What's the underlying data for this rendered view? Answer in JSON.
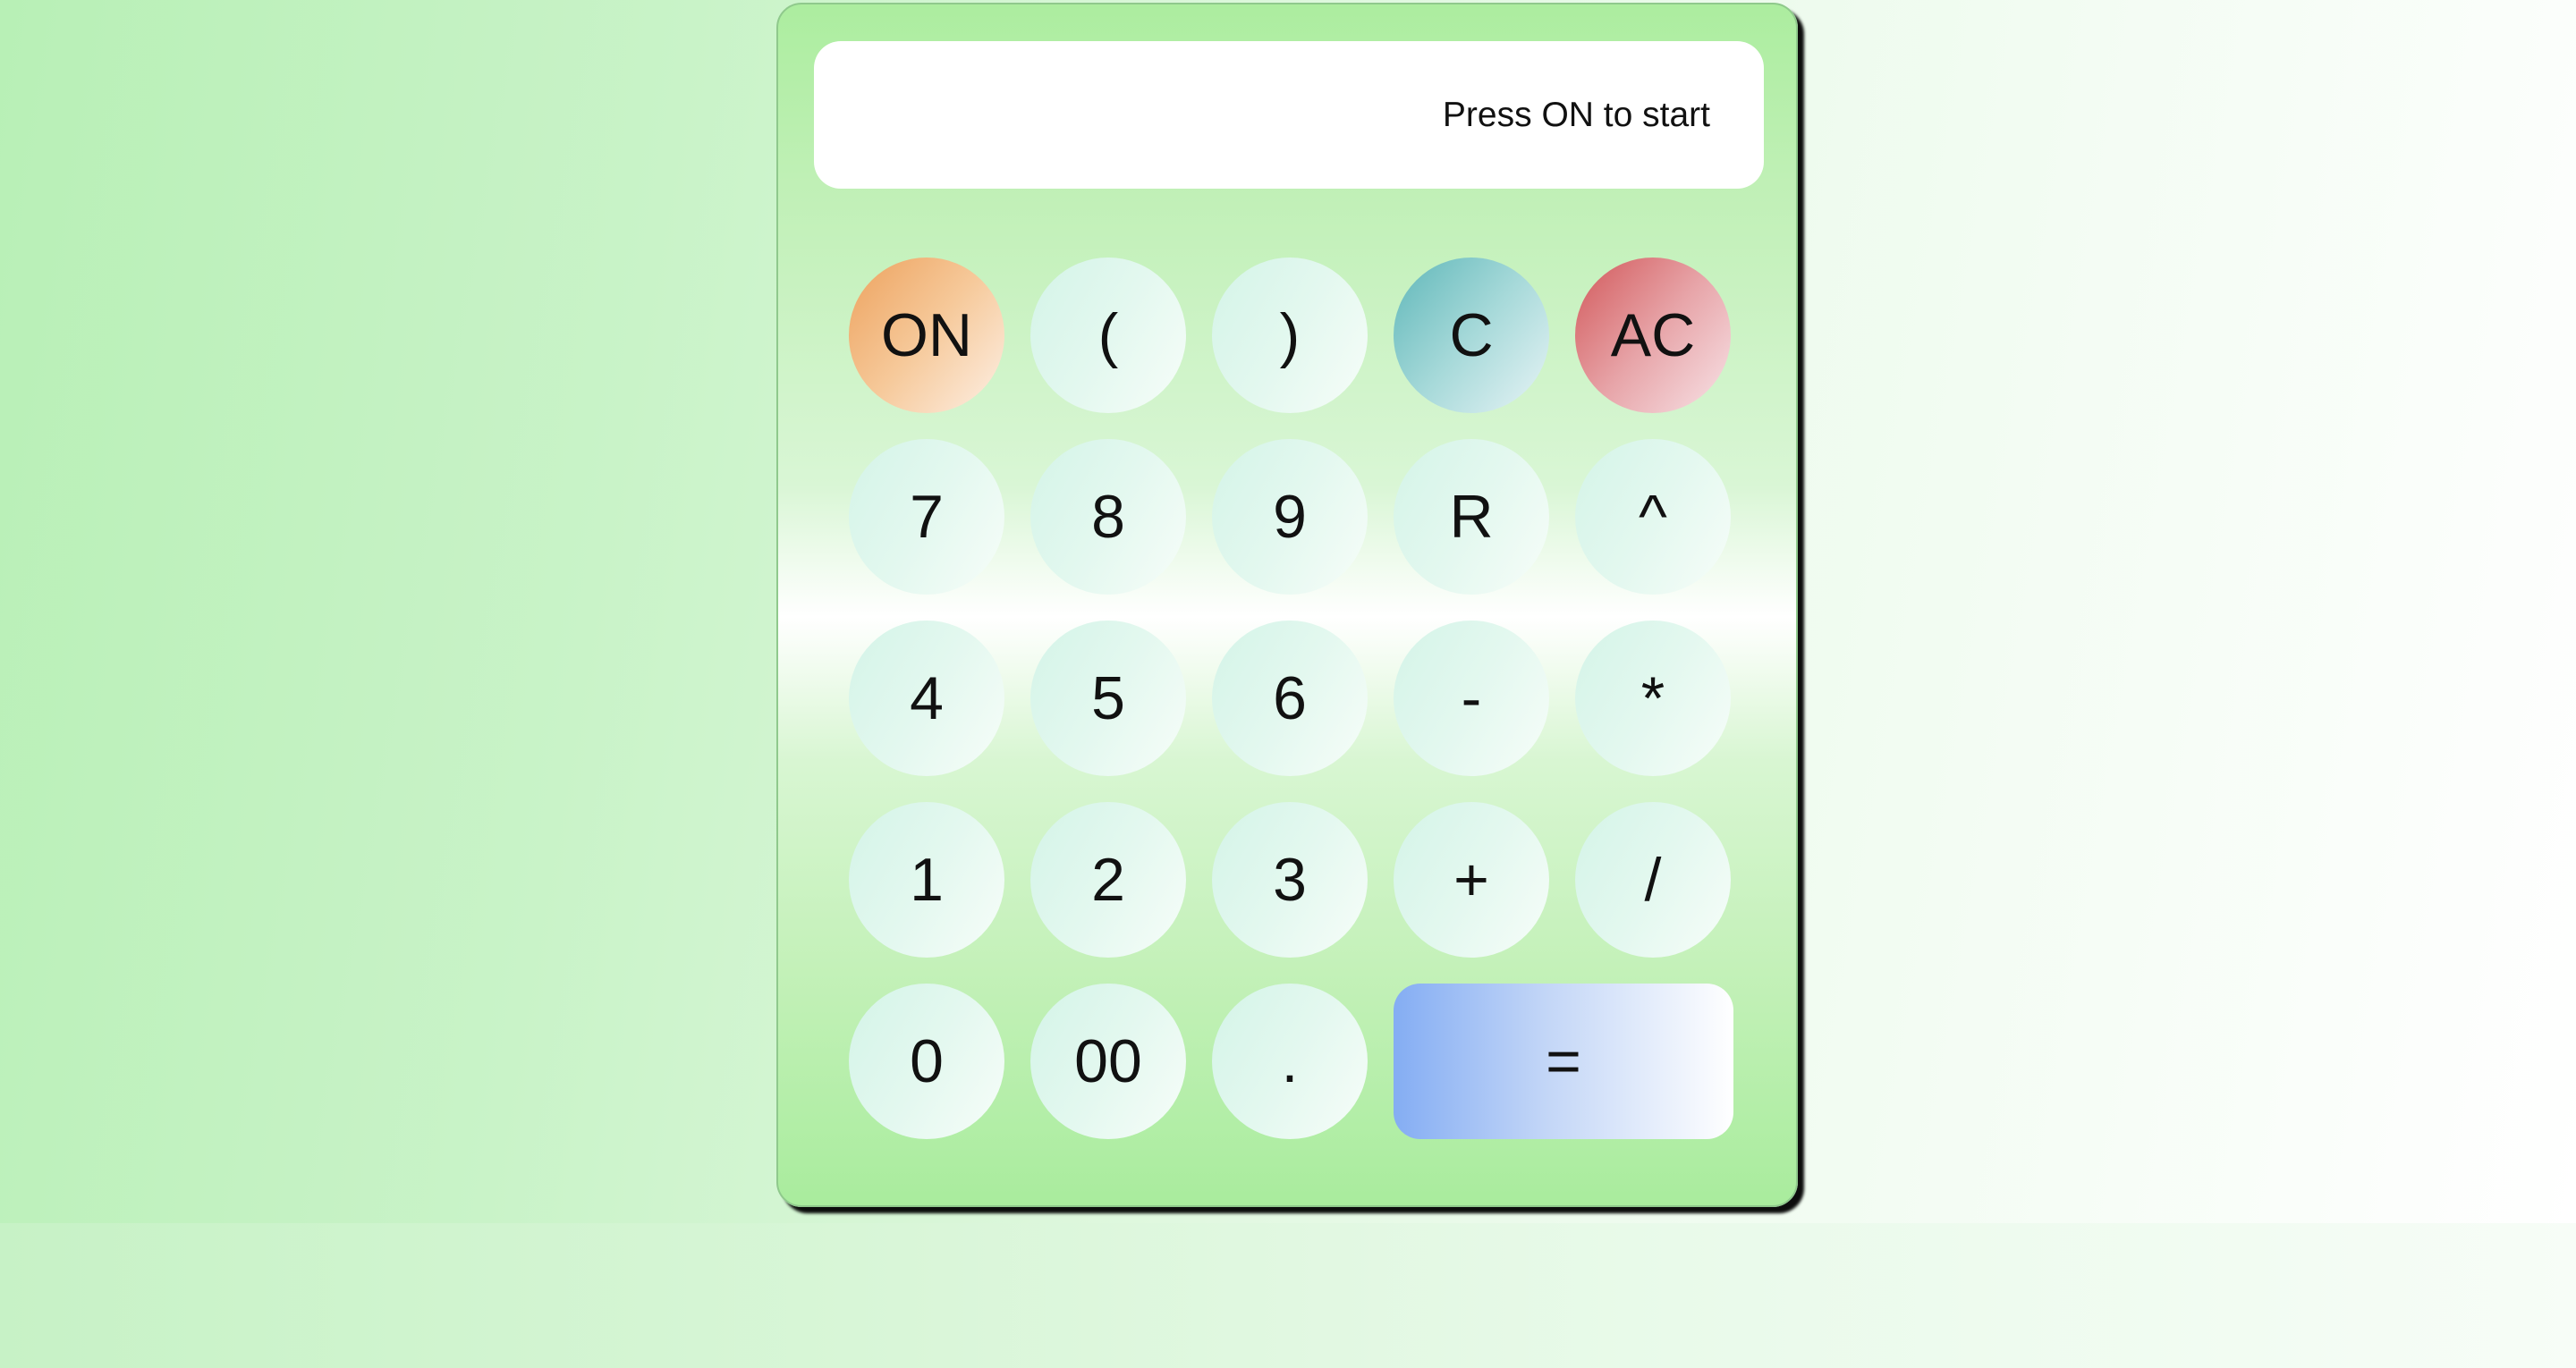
{
  "display": {
    "text": "Press ON to start"
  },
  "keys": {
    "on": "ON",
    "lparen": "(",
    "rparen": ")",
    "clear": "C",
    "all_clear": "AC",
    "seven": "7",
    "eight": "8",
    "nine": "9",
    "root": "R",
    "power": "^",
    "four": "4",
    "five": "5",
    "six": "6",
    "minus": "-",
    "multiply": "*",
    "one": "1",
    "two": "2",
    "three": "3",
    "plus": "+",
    "divide": "/",
    "zero": "0",
    "double_zero": "00",
    "decimal": ".",
    "equals": "="
  },
  "colors": {
    "on_button": "#eda25e",
    "clear_button": "#5fb7b9",
    "all_clear_button": "#d2585a",
    "equals_button": "#84adf3",
    "calculator_body": "#aced9f"
  }
}
